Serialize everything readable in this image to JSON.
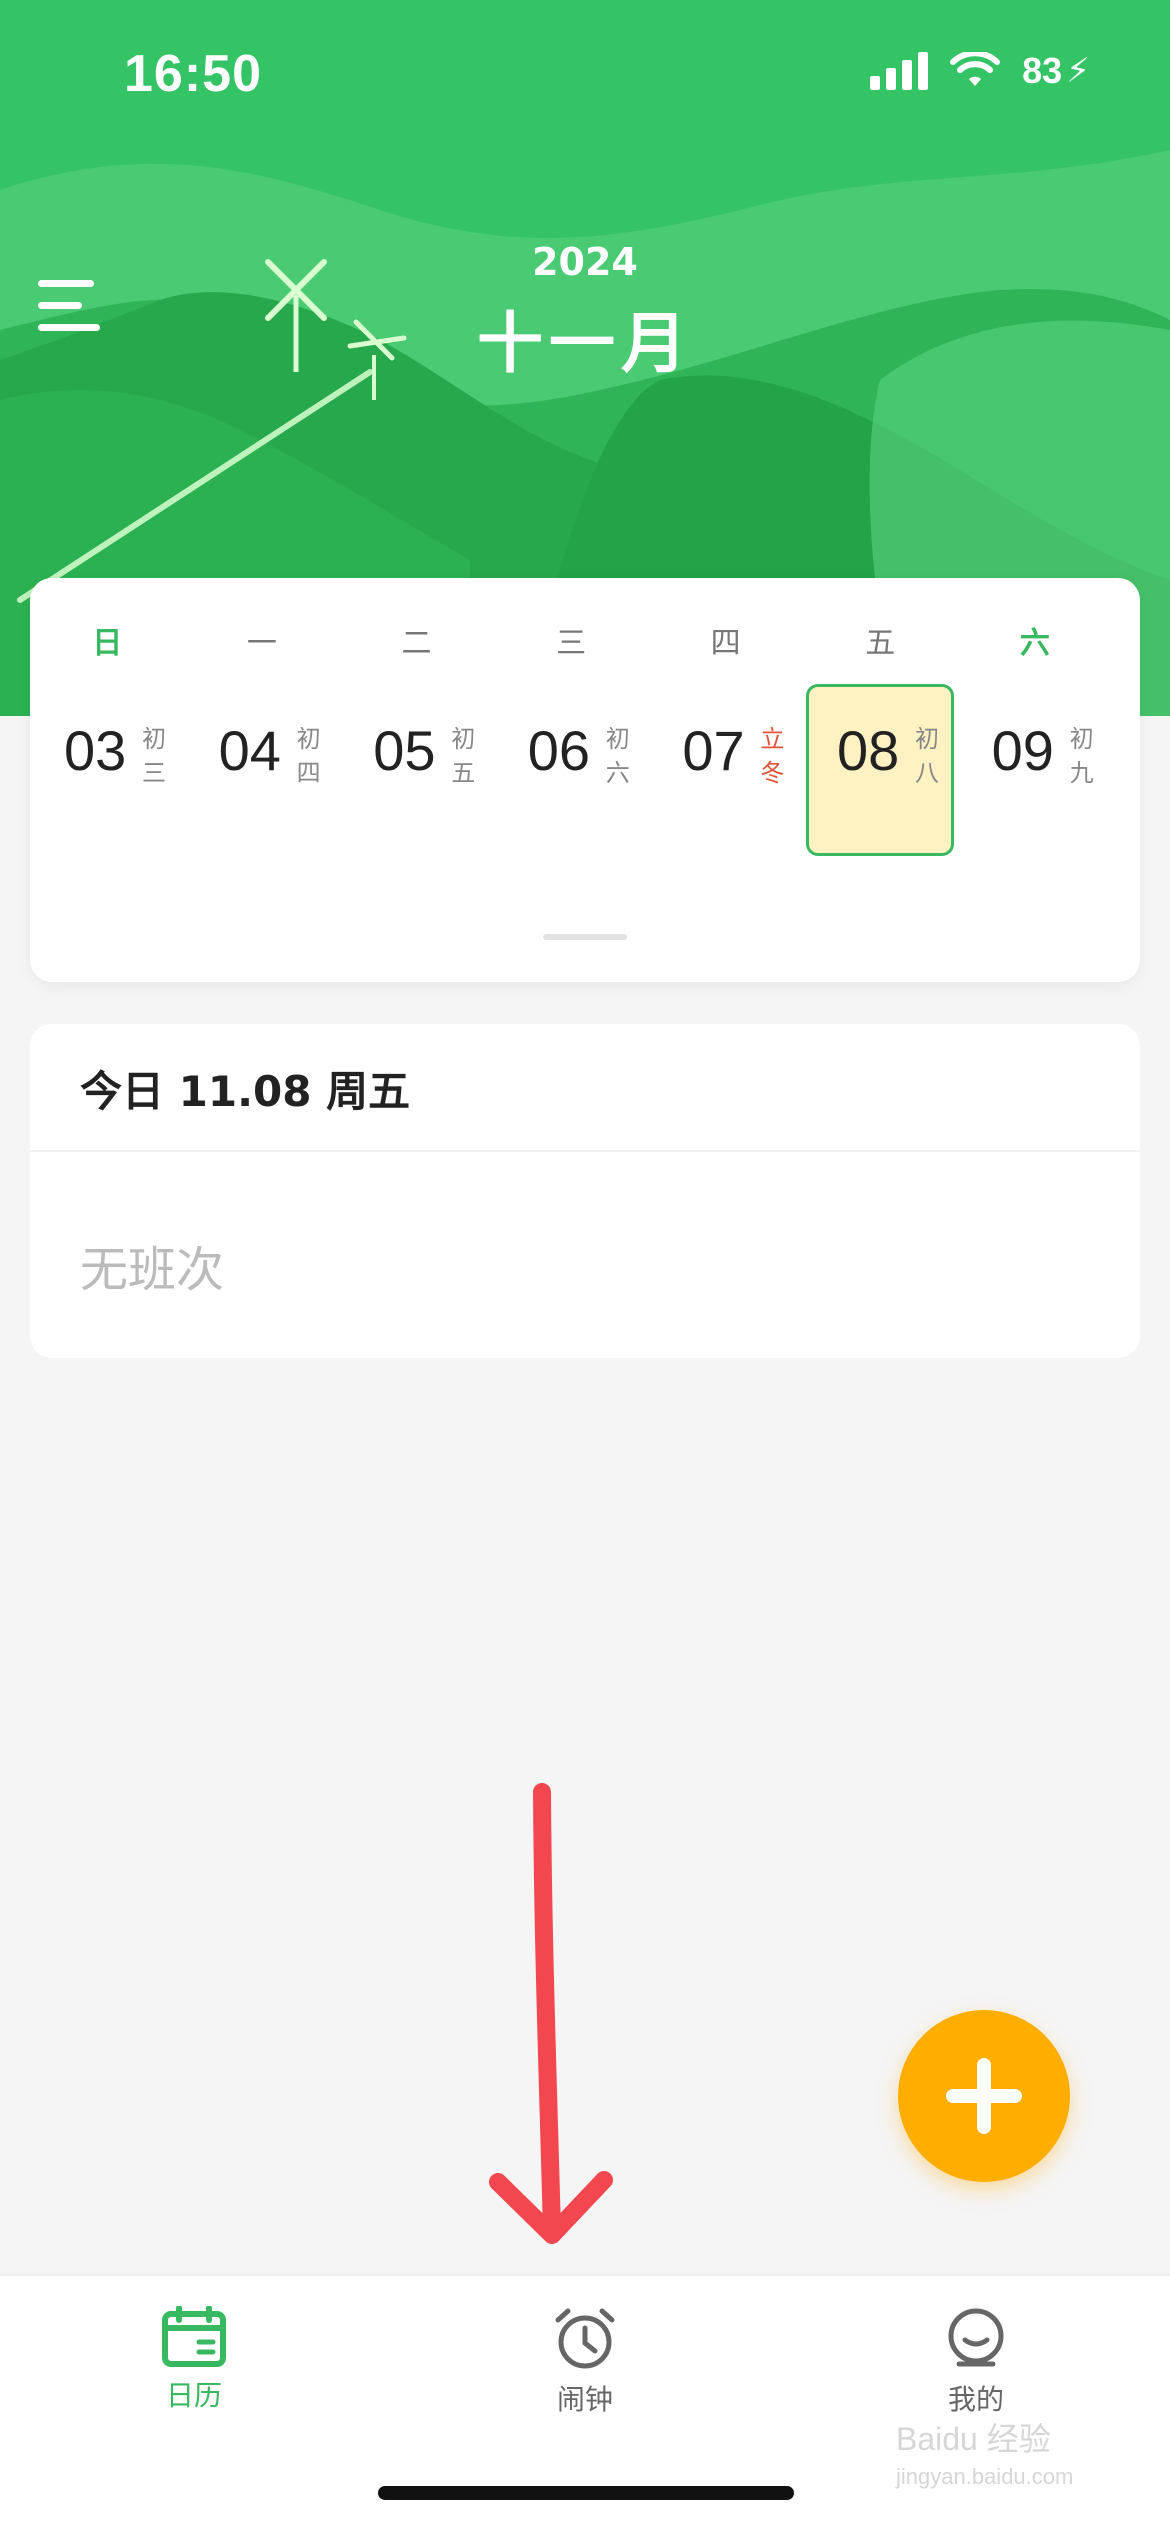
{
  "status_bar": {
    "time": "16:50",
    "battery": "83"
  },
  "header": {
    "year": "2024",
    "month": "十一月"
  },
  "calendar": {
    "weekdays": [
      "日",
      "一",
      "二",
      "三",
      "四",
      "五",
      "六"
    ],
    "days": [
      {
        "num": "03",
        "lunar_top": "初",
        "lunar_bottom": "三"
      },
      {
        "num": "04",
        "lunar_top": "初",
        "lunar_bottom": "四"
      },
      {
        "num": "05",
        "lunar_top": "初",
        "lunar_bottom": "五"
      },
      {
        "num": "06",
        "lunar_top": "初",
        "lunar_bottom": "六"
      },
      {
        "num": "07",
        "lunar_top": "立",
        "lunar_bottom": "冬"
      },
      {
        "num": "08",
        "lunar_top": "初",
        "lunar_bottom": "八"
      },
      {
        "num": "09",
        "lunar_top": "初",
        "lunar_bottom": "九"
      }
    ],
    "selected_day": "08"
  },
  "today": {
    "title": "今日 11.08 周五",
    "empty_text": "无班次"
  },
  "tabs": [
    {
      "label": "日历",
      "icon": "calendar-icon",
      "active": true
    },
    {
      "label": "闹钟",
      "icon": "alarm-clock-icon",
      "active": false
    },
    {
      "label": "我的",
      "icon": "profile-icon",
      "active": false
    }
  ],
  "watermark": {
    "line1": "Baidu 经验",
    "line2": "jingyan.baidu.com"
  },
  "colors": {
    "primary": "#36c466",
    "accent": "#ffae00",
    "highlight": "#fff2c2",
    "festival": "#e0533b",
    "arrow": "#f2474e"
  }
}
